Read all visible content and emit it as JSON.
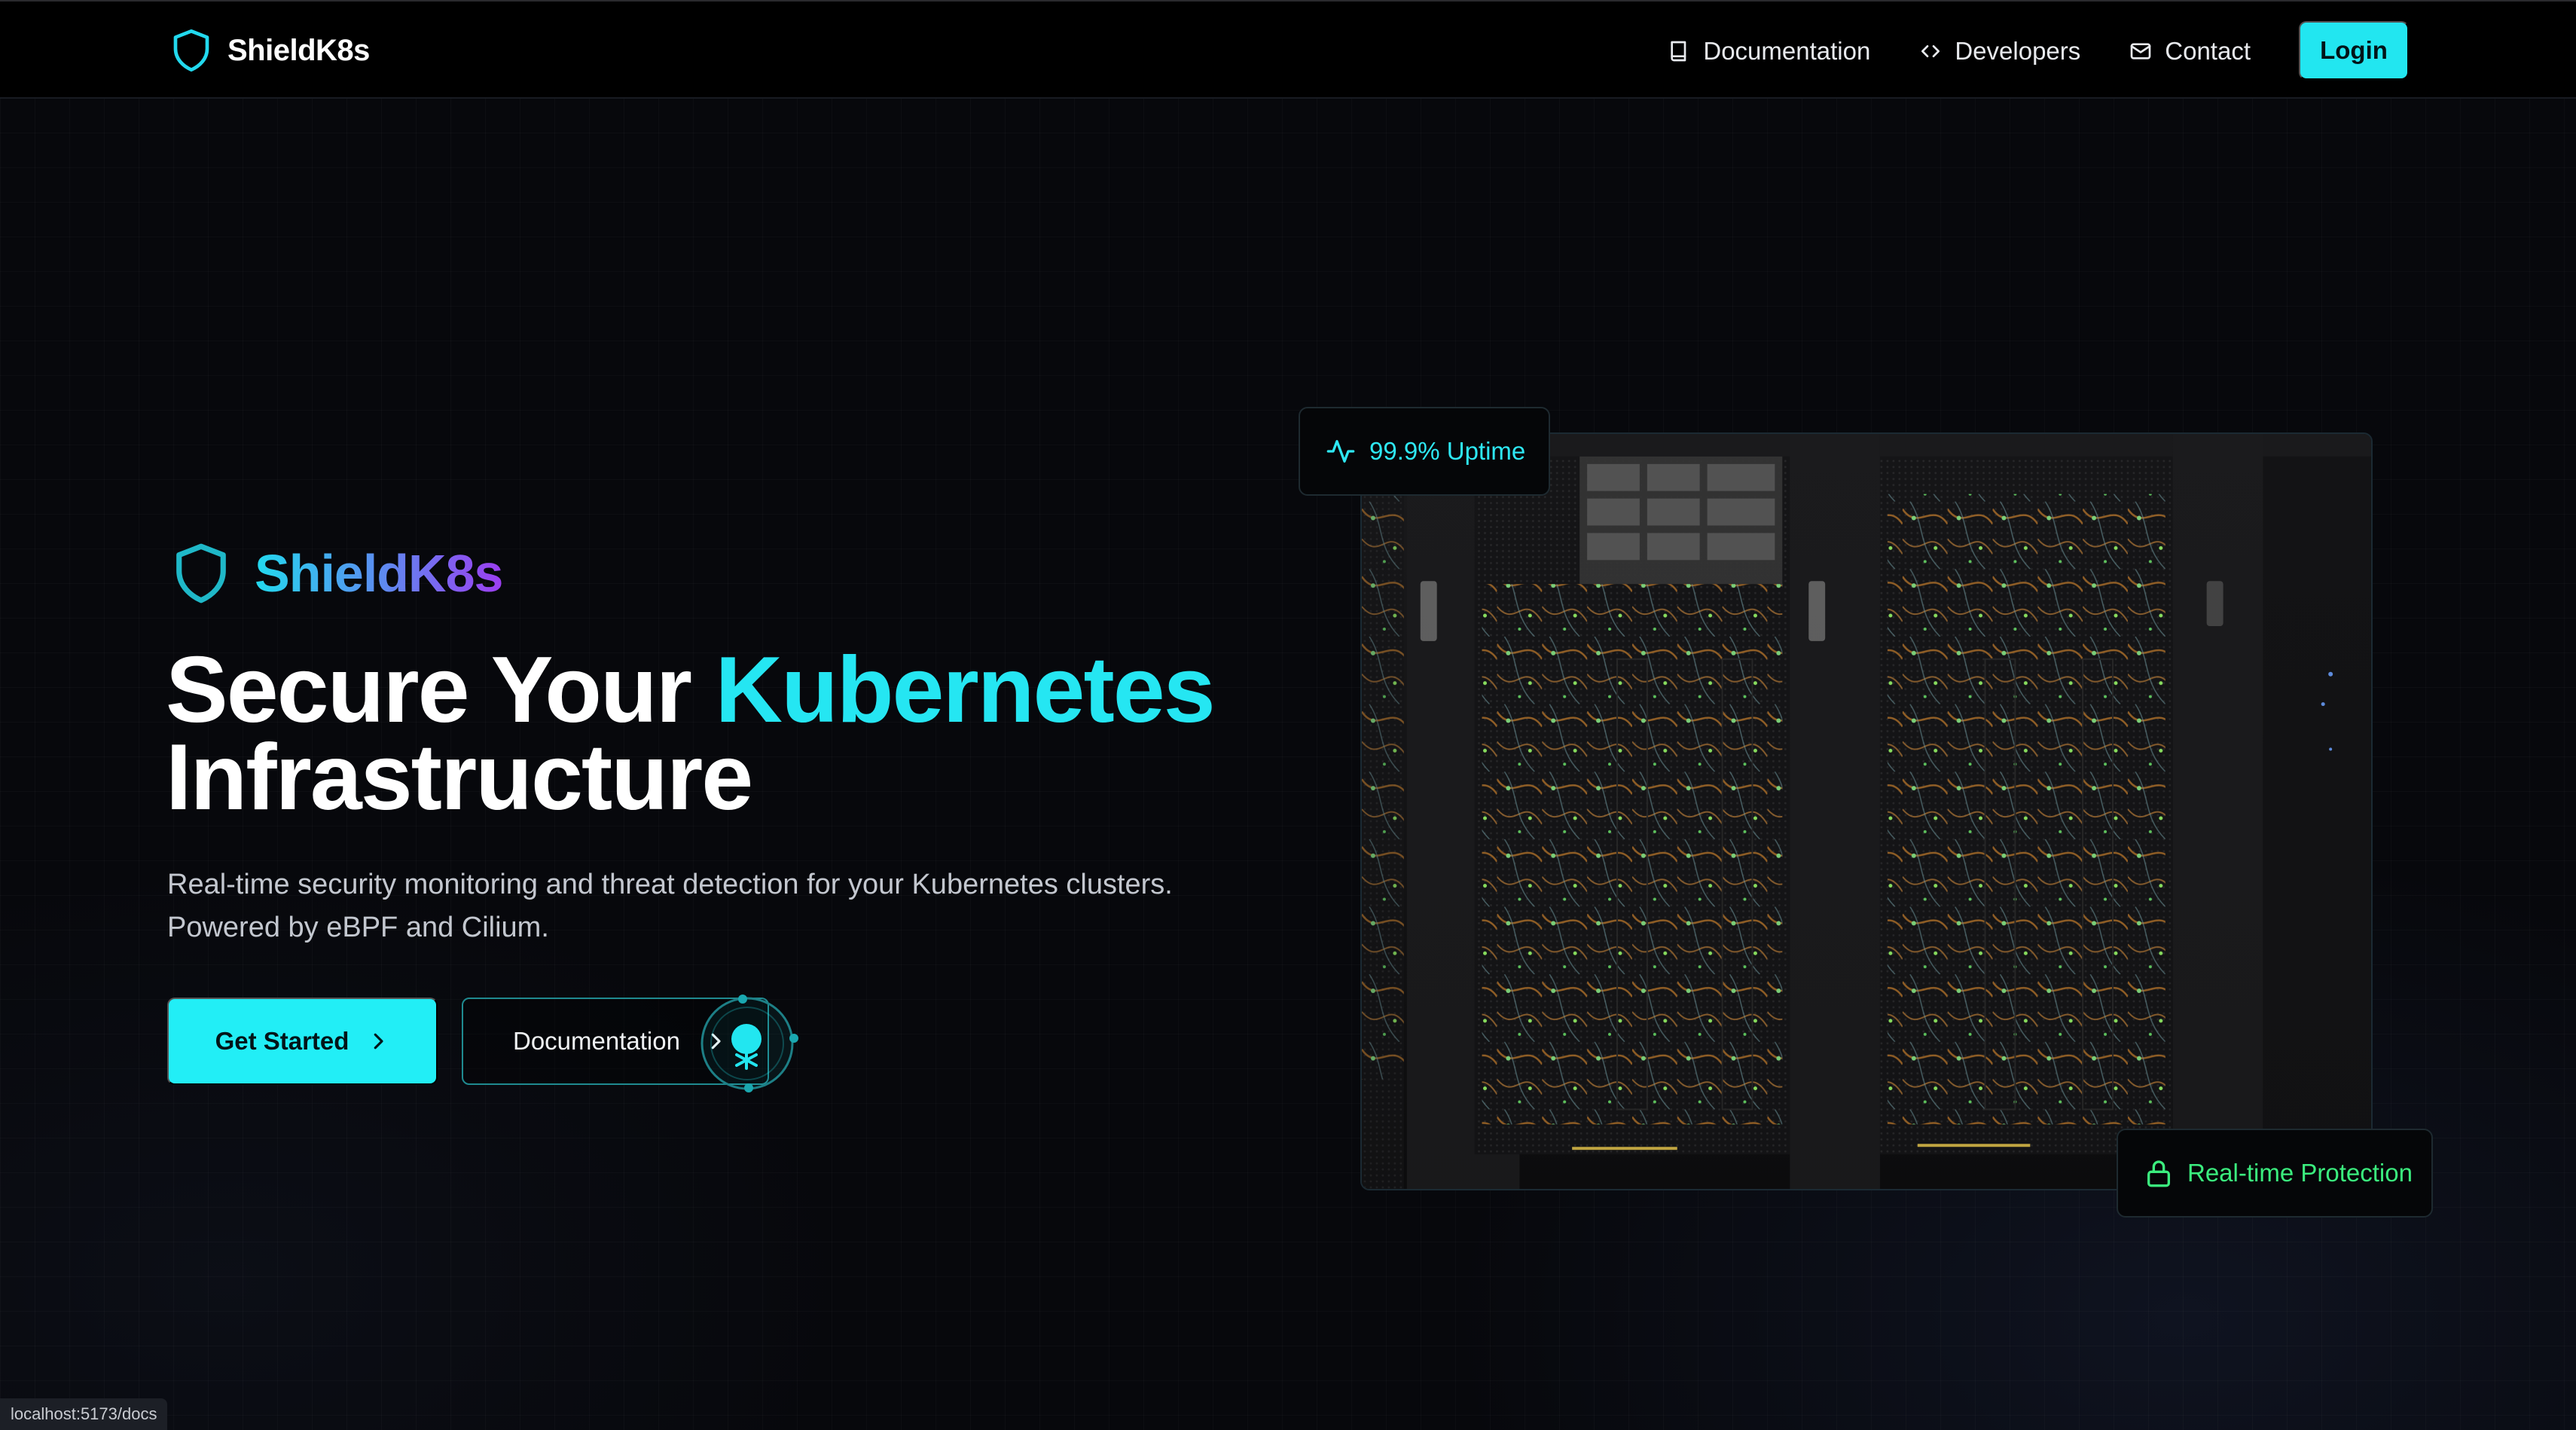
{
  "nav": {
    "brand": "ShieldK8s",
    "links": [
      {
        "label": "Documentation",
        "icon": "book-icon"
      },
      {
        "label": "Developers",
        "icon": "code-icon"
      },
      {
        "label": "Contact",
        "icon": "mail-icon"
      }
    ],
    "login_label": "Login"
  },
  "hero": {
    "brand": "ShieldK8s",
    "headline_part1": "Secure Your ",
    "headline_accent": "Kubernetes",
    "headline_part2": "Infrastructure",
    "subtext": "Real-time security monitoring and threat detection for your Kubernetes clusters. Powered by eBPF and Cilium.",
    "cta_label": "Get Started",
    "docs_label": "Documentation"
  },
  "badges": {
    "uptime": "99.9% Uptime",
    "protection": "Real-time Protection"
  },
  "status_bar": {
    "url": "localhost:5173/docs"
  },
  "colors": {
    "accent": "#22e6f0",
    "gradient_start": "#22d9ee",
    "gradient_end": "#9c3ef0",
    "protection_green": "#3bed7e",
    "background": "#07080c"
  },
  "icons": {
    "logo": "shield-icon",
    "uptime": "activity-icon",
    "protection": "lock-icon",
    "cta": "chevron-right-icon"
  }
}
